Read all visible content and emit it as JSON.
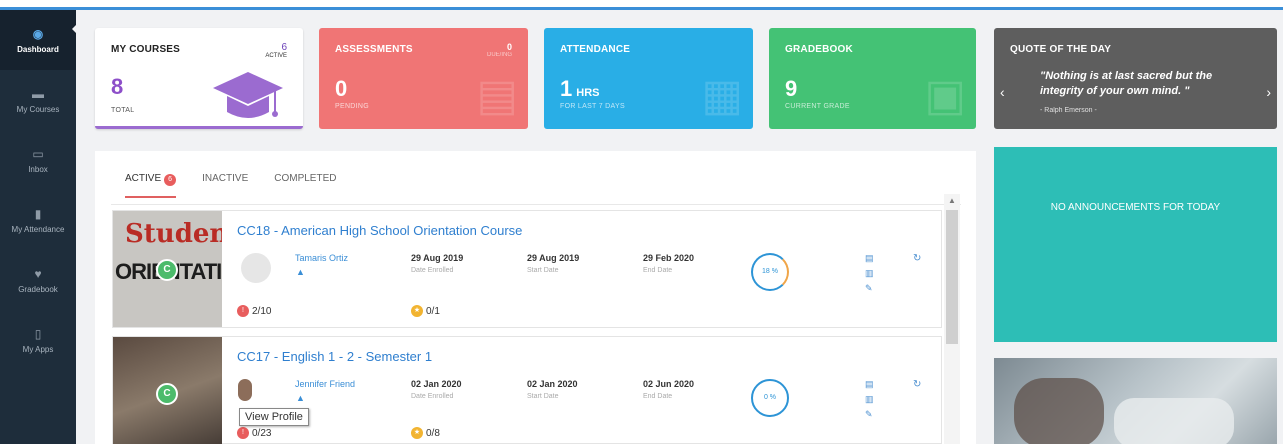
{
  "sidebar": {
    "items": [
      {
        "label": "Dashboard",
        "icon": "dashboard-icon",
        "glyph": "◉"
      },
      {
        "label": "My Courses",
        "icon": "courses-icon",
        "glyph": "▬"
      },
      {
        "label": "Inbox",
        "icon": "inbox-icon",
        "glyph": "▭"
      },
      {
        "label": "My Attendance",
        "icon": "attendance-icon",
        "glyph": "▮"
      },
      {
        "label": "Gradebook",
        "icon": "gradebook-icon",
        "glyph": "♥"
      },
      {
        "label": "My Apps",
        "icon": "apps-icon",
        "glyph": "▯"
      }
    ]
  },
  "cards": {
    "courses": {
      "title": "MY COURSES",
      "active_count": "6",
      "active_label": "ACTIVE",
      "total": "8",
      "total_label": "TOTAL"
    },
    "assessments": {
      "title": "ASSESSMENTS",
      "count": "0",
      "label": "PENDING",
      "due_count": "0",
      "due_label": "DUE/ING"
    },
    "attendance": {
      "title": "ATTENDANCE",
      "value": "1",
      "unit": "HRS",
      "label": "FOR LAST 7 DAYS"
    },
    "gradebook": {
      "title": "GRADEBOOK",
      "value": "9",
      "label": "CURRENT GRADE"
    },
    "quote": {
      "title": "QUOTE OF THE DAY",
      "text": "\"Nothing is at last sacred but the integrity of your own mind. \"",
      "author": "- Ralph Emerson -"
    }
  },
  "announcements": {
    "text": "NO ANNOUNCEMENTS FOR TODAY"
  },
  "tabs": [
    {
      "label": "ACTIVE",
      "badge": "6"
    },
    {
      "label": "INACTIVE"
    },
    {
      "label": "COMPLETED"
    }
  ],
  "courses": [
    {
      "title": "CC18 - American High School Orientation Course",
      "thumb_line1": "Student",
      "thumb_line2": "ORIENTATION",
      "badge": "C",
      "instructor": "Tamaris Ortiz",
      "enrolled": "29 Aug 2019",
      "enrolled_label": "Date Enrolled",
      "start": "29 Aug 2019",
      "start_label": "Start Date",
      "end": "29 Feb 2020",
      "end_label": "End Date",
      "progress": "18 %",
      "stat1": "2/10",
      "stat2": "0/1"
    },
    {
      "title": "CC17 - English 1 - 2 - Semester 1",
      "badge": "C",
      "instructor": "Jennifer Friend",
      "enrolled": "02 Jan 2020",
      "enrolled_label": "Date Enrolled",
      "start": "02 Jan 2020",
      "start_label": "Start Date",
      "end": "02 Jun 2020",
      "end_label": "End Date",
      "progress": "0 %",
      "stat1": "0/23",
      "stat2": "0/8"
    }
  ],
  "tooltip": "View Profile",
  "colors": {
    "accent": "#3b8fd8",
    "purple": "#8d4fc9",
    "red": "#f07575",
    "blue": "#29aee6",
    "green": "#44c275",
    "teal": "#2dbeb6"
  }
}
